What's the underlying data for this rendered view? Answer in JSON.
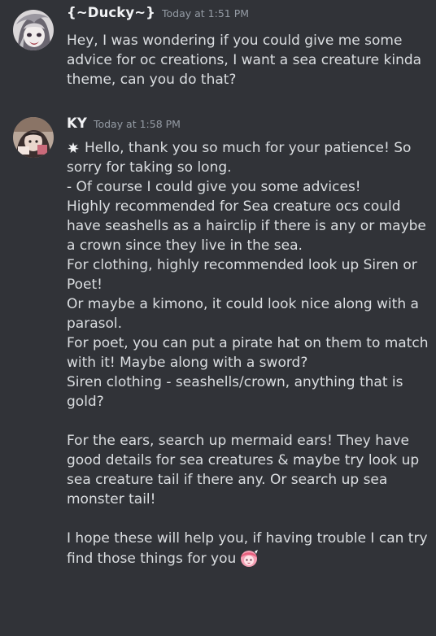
{
  "messages": [
    {
      "author": "{~Ducky~}",
      "timestamp": "Today at 1:51 PM",
      "lines": [
        "Hey, I was wondering if you could give me some",
        "advice for oc creations, I want a sea creature kinda",
        "theme, can you do that?"
      ]
    },
    {
      "author": "KY",
      "timestamp": "Today at 1:58 PM",
      "lines": [
        "Hello, thank you so much for your patience! So",
        "sorry for taking so long.",
        "- Of course I could give you some advices!",
        "Highly recommended for Sea creature ocs could",
        "have seashells as a hairclip if there is any or maybe",
        "a crown since they live in the sea.",
        "For clothing, highly recommended look up Siren or",
        "Poet!",
        "Or maybe a kimono, it could look nice along with a",
        "parasol.",
        "For poet, you can put a pirate hat on them to match",
        "with it! Maybe along with a sword?",
        "Siren clothing - seashells/crown, anything that is",
        "gold?",
        "",
        "For the ears, search up mermaid ears! They have",
        "good details for sea creatures & maybe try look up",
        "sea creature tail if there any. Or search up sea",
        "monster tail!",
        "",
        "I hope these will help you, if having trouble I can try",
        "find those things for you"
      ]
    }
  ],
  "icons": {
    "leading_emoji": "sparkle-burst-icon",
    "trailing_emoji": "pink-character-emoji"
  },
  "colors": {
    "background": "#313338",
    "username": "#f2f3f5",
    "timestamp": "#949ba4",
    "text": "#dbdee1"
  }
}
